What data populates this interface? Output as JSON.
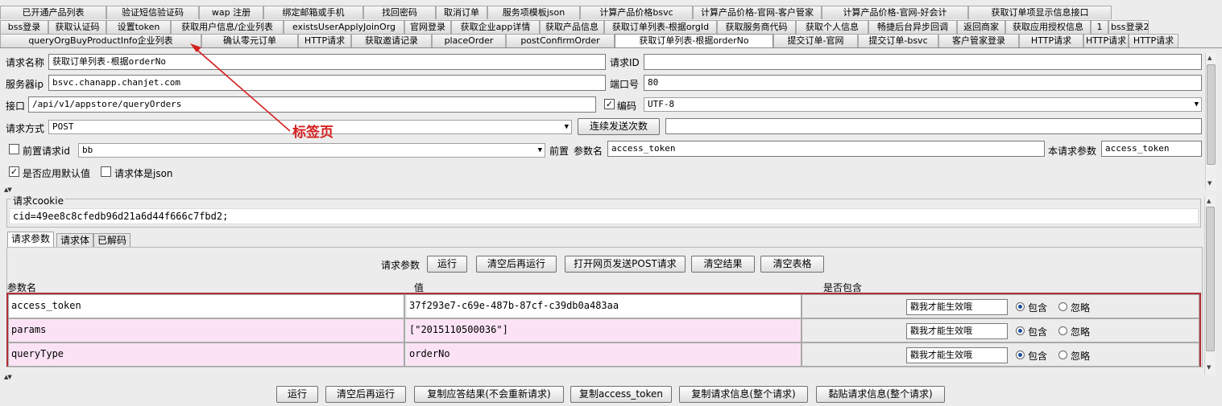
{
  "tabs": {
    "row1": [
      "已开通产品列表",
      "验证短信验证码",
      "wap 注册",
      "绑定邮箱或手机",
      "找回密码",
      "取消订单",
      "服务项模板json",
      "计算产品价格bsvc",
      "计算产品价格-官网-客户管家",
      "计算产品价格-官网-好会计",
      "获取订单项显示信息接口"
    ],
    "row2": [
      "bss登录",
      "获取认证码",
      "设置token",
      "获取用户信息/企业列表",
      "existsUserApplyJoinOrg",
      "官网登录",
      "获取企业app详情",
      "获取产品信息",
      "获取订单列表-根据orgId",
      "获取服务商代码",
      "获取个人信息",
      "畅捷后台异步回调",
      "返回商家",
      "获取应用授权信息",
      "1",
      "bss登录2"
    ],
    "row3": [
      "queryOrgBuyProductInfo企业列表",
      "确认零元订单",
      "HTTP请求",
      "获取邀请记录",
      "placeOrder",
      "postConfirmOrder",
      "获取订单列表-根据orderNo",
      "提交订单-官网",
      "提交订单-bsvc",
      "客户管家登录",
      "HTTP请求",
      "HTTP请求",
      "HTTP请求"
    ],
    "selected_row3_index": 6
  },
  "form": {
    "req_name_label": "请求名称",
    "req_name_value": "获取订单列表-根据orderNo",
    "req_id_label": "请求ID",
    "req_id_value": "",
    "server_ip_label": "服务器ip",
    "server_ip_value": "bsvc.chanapp.chanjet.com",
    "port_label": "端口号",
    "port_value": "80",
    "api_label": "接口",
    "api_value": "/api/v1/appstore/queryOrders",
    "encoding_checkbox_label": "编码",
    "encoding_checked": true,
    "encoding_value": "UTF-8",
    "method_label": "请求方式",
    "method_value": "POST",
    "repeat_button": "连续发送次数",
    "repeat_value": "",
    "pre_req_label": "前置请求id",
    "pre_req_checked": false,
    "pre_req_value": "bb",
    "pre_label": "前置",
    "param_name_label": "参数名",
    "param_name_value": "access_token",
    "this_param_label": "本请求参数",
    "this_param_value": "access_token",
    "use_default_label": "是否应用默认值",
    "use_default_checked": true,
    "body_json_label": "请求体是json",
    "body_json_checked": false
  },
  "cookie": {
    "title": "请求cookie",
    "value": "cid=49ee8c8cfedb96d21a6d44f666c7fbd2;"
  },
  "param_tabs": [
    "请求参数",
    "请求体",
    "已解码"
  ],
  "param_toolbar": {
    "label": "请求参数",
    "buttons": [
      "运行",
      "清空后再运行",
      "打开网页发送POST请求",
      "清空结果",
      "清空表格"
    ]
  },
  "param_table": {
    "headers": [
      "参数名",
      "值",
      "是否包含"
    ],
    "rows": [
      {
        "name": "access_token",
        "value": "37f293e7-c69e-487b-87cf-c39db0a483aa",
        "hint": "戳我才能生效哦",
        "include": "包含",
        "ignore": "忽略",
        "bg": "#ffffff"
      },
      {
        "name": "params",
        "value": "[\"2015110500036\"]",
        "hint": "戳我才能生效哦",
        "include": "包含",
        "ignore": "忽略",
        "bg": "#fbe3f5"
      },
      {
        "name": "queryType",
        "value": "orderNo",
        "hint": "戳我才能生效哦",
        "include": "包含",
        "ignore": "忽略",
        "bg": "#fbe3f5"
      }
    ]
  },
  "bottom_buttons": [
    "运行",
    "清空后再运行",
    "复制应答结果(不会重新请求)",
    "复制access_token",
    "复制请求信息(整个请求)",
    "黏贴请求信息(整个请求)"
  ],
  "annotation": "标签页",
  "colors": {
    "annotation": "#d42020",
    "table_border": "#b0303a",
    "row_pink": "#fbe3f5"
  }
}
